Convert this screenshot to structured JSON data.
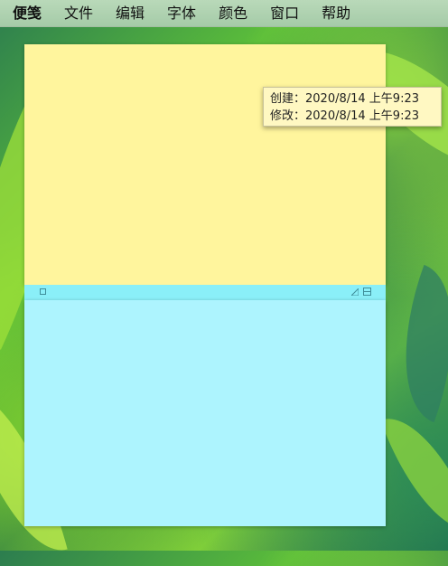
{
  "menubar": {
    "app_name": "便笺",
    "items": [
      "文件",
      "编辑",
      "字体",
      "颜色",
      "窗口",
      "帮助"
    ]
  },
  "tooltip": {
    "created_label": "创建：",
    "created_value": "2020/8/14 上午9:23",
    "modified_label": "修改：",
    "modified_value": "2020/8/14 上午9:23"
  },
  "notes": {
    "yellow": {
      "color": "#fff59d",
      "text": ""
    },
    "blue": {
      "color": "#adf4fe",
      "titlebar_color": "#8aeff8",
      "text": ""
    }
  },
  "icons": {
    "close": "close-box-icon",
    "collapse": "collapse-triangle-icon",
    "zoom": "zoom-box-icon"
  }
}
